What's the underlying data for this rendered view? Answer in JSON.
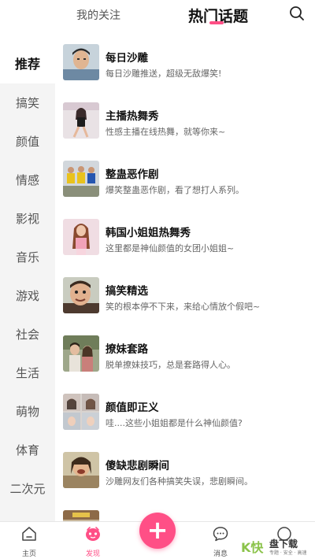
{
  "header": {
    "tabs": [
      {
        "label": "我的关注",
        "active": false
      },
      {
        "label": "热门话题",
        "active": true
      }
    ],
    "search_icon": "search-icon",
    "accent_color": "#ff4f86"
  },
  "sidebar": {
    "items": [
      {
        "label": "推荐",
        "active": true
      },
      {
        "label": "搞笑",
        "active": false
      },
      {
        "label": "颜值",
        "active": false
      },
      {
        "label": "情感",
        "active": false
      },
      {
        "label": "影视",
        "active": false
      },
      {
        "label": "音乐",
        "active": false
      },
      {
        "label": "游戏",
        "active": false
      },
      {
        "label": "社会",
        "active": false
      },
      {
        "label": "生活",
        "active": false
      },
      {
        "label": "萌物",
        "active": false
      },
      {
        "label": "体育",
        "active": false
      },
      {
        "label": "二次元",
        "active": false
      }
    ]
  },
  "topics": [
    {
      "title": "每日沙雕",
      "desc": "每日沙雕推送，超级无敌爆笑!"
    },
    {
      "title": "主播热舞秀",
      "desc": "性感主播在线热舞，就等你来~"
    },
    {
      "title": "整蛊恶作剧",
      "desc": "爆笑整蛊恶作剧，看了想打人系列。"
    },
    {
      "title": "韩国小姐姐热舞秀",
      "desc": "这里都是神仙颜值的女团小姐姐~"
    },
    {
      "title": "搞笑精选",
      "desc": "笑的根本停不下来，来给心情放个假吧~"
    },
    {
      "title": "撩妹套路",
      "desc": "脱单撩妹技巧，总是套路得人心。"
    },
    {
      "title": "颜值即正义",
      "desc": "哇....这些小姐姐都是什么神仙颜值?"
    },
    {
      "title": "傻缺悲剧瞬间",
      "desc": "沙雕网友们各种搞笑失误，悲剧瞬间。"
    }
  ],
  "bottom_nav": {
    "items": [
      {
        "label": "主页",
        "icon": "home-icon",
        "active": false
      },
      {
        "label": "发现",
        "icon": "discover-icon",
        "active": true
      },
      {
        "label": "消息",
        "icon": "message-icon",
        "active": false
      }
    ],
    "add_icon": "plus-icon",
    "add_symbol": "+"
  },
  "watermark": {
    "logo": "K快",
    "title": "盘下载",
    "subtitle": "专题 · 安全 · 高速"
  }
}
